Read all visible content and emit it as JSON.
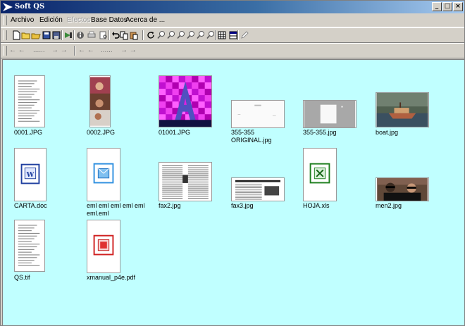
{
  "window": {
    "title": "Soft QS",
    "controls": [
      "_",
      "□",
      "×"
    ]
  },
  "menu": [
    "Archivo",
    "Edición",
    "Efectos",
    "Base Datos",
    "Acerca de ..."
  ],
  "menu_disabled": [
    "Efectos"
  ],
  "toolbar1_icons": [
    "new-file-icon",
    "open-folder-icon",
    "open-icon",
    "save-icon",
    "save-as-icon",
    "scanner-icon",
    "info-icon",
    "print-icon",
    "print-preview-icon",
    "undo-icon",
    "copy-icon",
    "paste-icon",
    "rotate-icon",
    "zoom-1-icon",
    "zoom-2-icon",
    "zoom-3-icon",
    "zoom-4-icon",
    "zoom-5-icon",
    "zoom-6-icon",
    "grid-icon",
    "table-icon",
    "edit-icon"
  ],
  "toolbar2_labels": [
    "← ←",
    "......",
    "→ →",
    "← ←",
    "......",
    "→ →"
  ],
  "files": [
    {
      "name": "0001.JPG",
      "kind": "doc-scan"
    },
    {
      "name": "0002.JPG",
      "kind": "photo-tall"
    },
    {
      "name": "01001.JPG",
      "kind": "magenta"
    },
    {
      "name": "355-355 ORIGINAL.jpg",
      "kind": "blank-wide"
    },
    {
      "name": "355-355.jpg",
      "kind": "grey-wide"
    },
    {
      "name": "boat.jpg",
      "kind": "boat"
    },
    {
      "name": "CARTA.doc",
      "kind": "word"
    },
    {
      "name": "eml eml eml eml eml eml.eml",
      "kind": "email"
    },
    {
      "name": "fax2.jpg",
      "kind": "fax"
    },
    {
      "name": "fax3.jpg",
      "kind": "fax-wide"
    },
    {
      "name": "HOJA.xls",
      "kind": "excel"
    },
    {
      "name": "men2.jpg",
      "kind": "men"
    },
    {
      "name": "QS.tif",
      "kind": "doc-scan"
    },
    {
      "name": "xmanual_p4e.pdf",
      "kind": "pdf"
    }
  ]
}
